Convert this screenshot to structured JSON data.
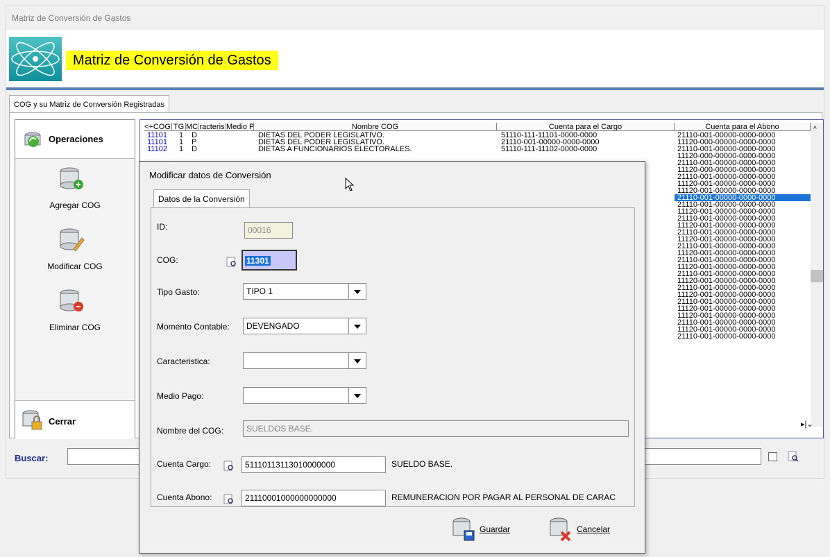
{
  "window": {
    "title": "Matriz de Conversión de Gastos",
    "header_title": "Matriz de Conversión de Gastos",
    "tab_label": "COG y su Matriz de Conversión Registradas"
  },
  "sidebar": {
    "section_title": "Operaciones",
    "items": [
      {
        "label": "Agregar COG",
        "icon": "database-add-icon"
      },
      {
        "label": "Modificar COG",
        "icon": "database-edit-icon"
      },
      {
        "label": "Eliminar COG",
        "icon": "database-remove-icon"
      }
    ],
    "close_label": "Cerrar"
  },
  "grid": {
    "headers": [
      "<+COG>",
      "TG",
      "MC",
      "racteris",
      "Medio Pa",
      "Nombre COG",
      "Cuenta para el Cargo",
      "Cuenta para el Abono"
    ],
    "rows": [
      [
        "11101",
        "1",
        "D",
        "",
        "",
        "DIETAS DEL PODER LEGISLATIVO.",
        "51110-111-11101-0000-0000",
        "21110-001-00000-0000-0000"
      ],
      [
        "11101",
        "1",
        "P",
        "",
        "",
        "DIETAS DEL PODER LEGISLATIVO.",
        "21110-001-00000-0000-0000",
        "11120-000-00000-0000-0000"
      ],
      [
        "11102",
        "1",
        "D",
        "",
        "",
        "DIETAS A FUNCIONARIOS ELECTORALES.",
        "51110-111-11102-0000-0000",
        "21110-001-00000-0000-0000"
      ]
    ],
    "abono_more": [
      "11120-000-00000-0000-0000",
      "21110-001-00000-0000-0000",
      "11120-000-00000-0000-0000",
      "21110-001-00000-0000-0000",
      "11120-001-00000-0000-0000",
      "11120-001-00000-0000-0000",
      "21110-001-00000-0000-0000",
      "21110-001-00000-0000-0000",
      "11120-001-00000-0000-0000",
      "21110-001-00000-0000-0000",
      "11120-001-00000-0000-0000",
      "21110-001-00000-0000-0000",
      "11120-001-00000-0000-0000",
      "21110-001-00000-0000-0000",
      "11120-001-00000-0000-0000",
      "21110-001-00000-0000-0000",
      "11120-001-00000-0000-0000",
      "21110-001-00000-0000-0000",
      "11120-001-00000-0000-0000",
      "21110-001-00000-0000-0000",
      "11120-001-00000-0000-0000",
      "21110-001-00000-0000-0000",
      "11120-001-00000-0000-0000",
      "11120-001-00000-0000-0000",
      "21110-001-00000-0000-0000",
      "11120-001-00000-0000-0000",
      "21110-001-00000-0000-0000"
    ],
    "selected_index": 6
  },
  "search": {
    "label": "Buscar:",
    "value": ""
  },
  "dialog": {
    "title": "Modificar datos de Conversión",
    "tab_label": "Datos de la Conversión",
    "fields": {
      "id_label": "ID:",
      "id_value": "00016",
      "cog_label": "COG:",
      "cog_value": "11301",
      "tipo_label": "Tipo Gasto:",
      "tipo_value": "TIPO 1",
      "momento_label": "Momento Contable:",
      "momento_value": "DEVENGADO",
      "caract_label": "Caracteristica:",
      "caract_value": "",
      "medio_label": "Medio Pago:",
      "medio_value": "",
      "nombre_label": "Nombre del COG:",
      "nombre_value": "SUELDOS BASE.",
      "cargo_label": "Cuenta Cargo:",
      "cargo_value": "51110113113010000000",
      "cargo_desc": "SUELDO BASE.",
      "abono_label": "Cuenta Abono:",
      "abono_value": "21110001000000000000",
      "abono_desc": "REMUNERACION POR PAGAR  AL PERSONAL DE CARAC"
    },
    "save_label": "Guardar",
    "cancel_label": "Cancelar"
  }
}
